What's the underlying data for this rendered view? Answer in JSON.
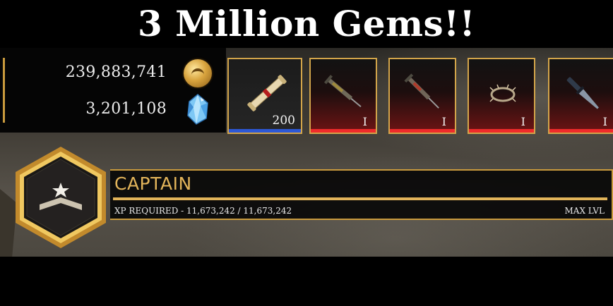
{
  "title": "3 Million Gems!!",
  "currency": {
    "gold": {
      "value": "239,883,741",
      "icon": "gold-coin-icon"
    },
    "gems": {
      "value": "3,201,108",
      "icon": "blue-gem-icon"
    }
  },
  "items": [
    {
      "name": "scroll",
      "icon": "scroll-icon",
      "label": "200",
      "rarity_color": "#2d58d6"
    },
    {
      "name": "syringe",
      "icon": "syringe-icon",
      "label": "I",
      "rarity_color": "#ef2b2b"
    },
    {
      "name": "syringe-2",
      "icon": "syringe-icon",
      "label": "I",
      "rarity_color": "#ef2b2b"
    },
    {
      "name": "barbed-ring",
      "icon": "barbed-ring-icon",
      "label": "I",
      "rarity_color": "#ef2b2b"
    },
    {
      "name": "knife",
      "icon": "knife-icon",
      "label": "I",
      "rarity_color": "#ef2b2b"
    }
  ],
  "rank": {
    "name": "CAPTAIN",
    "xp_text": "XP REQUIRED - 11,673,242 / 11,673,242",
    "xp_progress": 1.0,
    "status": "MAX LVL",
    "badge_icon": "captain-rank-badge-icon"
  },
  "colors": {
    "gold": "#c99a3d",
    "rank_text": "#e2b45a",
    "rare_red": "#ef2b2b",
    "common_blue": "#2d58d6"
  }
}
